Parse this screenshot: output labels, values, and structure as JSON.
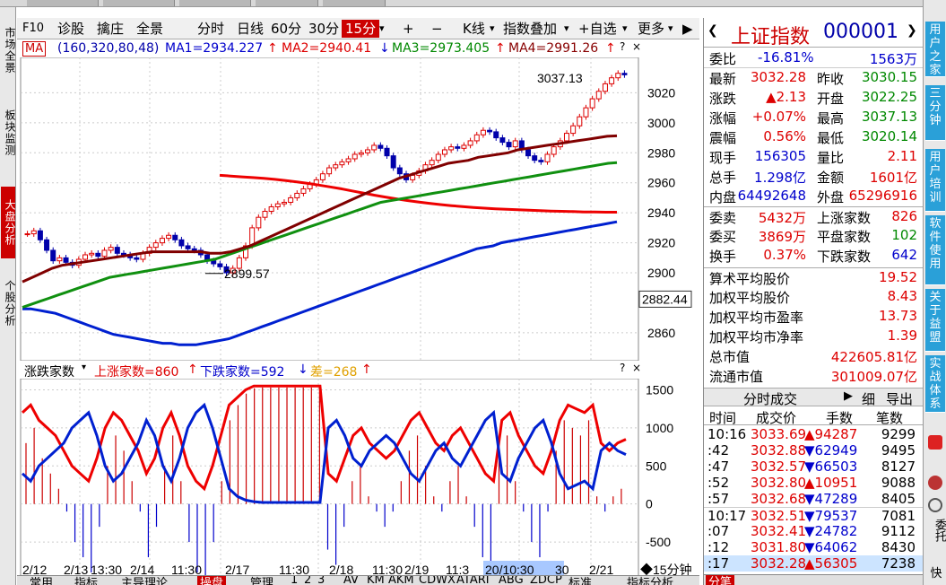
{
  "toolbar": {
    "items": [
      "F10",
      "诊股",
      "擒庄",
      "全景",
      "分时",
      "日线",
      "60分",
      "30分",
      "15分",
      "▾",
      "+",
      "−",
      "K线",
      "▾",
      "指数叠加",
      "▾",
      "+自选",
      "▾",
      "更多",
      "▾"
    ],
    "selected": "15分"
  },
  "left_tabs": [
    "市场全景",
    "板块监测",
    "大盘分析",
    "个股分析"
  ],
  "left_active": "大盘分析",
  "main_header": {
    "ma_label": "MA",
    "params": "(160,320,80,48)",
    "ma1": "MA1=2934.227",
    "ma2": "MA2=2940.41",
    "ma3": "MA3=2973.405",
    "ma4": "MA4=2991.26",
    "arrow_up": "↑",
    "arrow_down": "↓",
    "close_x": "×",
    "nav_right": "▶"
  },
  "sub_header": {
    "title": "涨跌家数",
    "up": "上涨家数=860",
    "down": "下跌家数=592",
    "diff": "差=268",
    "arrow_up": "↑",
    "arrow_down": "↓",
    "help": "?",
    "close_x": "×"
  },
  "price_tag": "2882.44",
  "max_annot": "3037.13",
  "min_annot": "2899.57",
  "x_ticks": [
    "2/12",
    "2/13",
    "13:30",
    "2/14",
    "11:30",
    "2/17",
    "11:30",
    "2/18",
    "11:30",
    "2/19",
    "11:3",
    "20/10:30",
    "30",
    "2/21"
  ],
  "x_period": "◆15分钟",
  "y_ticks_main": [
    "3020",
    "3000",
    "2980",
    "2960",
    "2940",
    "2920",
    "2900",
    "2860"
  ],
  "y_ticks_sub": [
    "1500",
    "1000",
    "500",
    "0",
    "-500"
  ],
  "chart_data": {
    "type": "line",
    "title": "",
    "xlabel": "",
    "ylabel": "",
    "ylim": [
      2845,
      3040
    ],
    "candles_close": [
      2926,
      2928,
      2922,
      2915,
      2908,
      2910,
      2907,
      2905,
      2909,
      2912,
      2913,
      2911,
      2915,
      2917,
      2913,
      2912,
      2910,
      2909,
      2913,
      2917,
      2920,
      2923,
      2925,
      2922,
      2918,
      2916,
      2915,
      2912,
      2908,
      2906,
      2904,
      2900,
      2903,
      2910,
      2918,
      2930,
      2937,
      2941,
      2944,
      2946,
      2947,
      2950,
      2953,
      2956,
      2959,
      2962,
      2966,
      2970,
      2972,
      2974,
      2976,
      2979,
      2980,
      2982,
      2985,
      2983,
      2978,
      2970,
      2966,
      2962,
      2965,
      2968,
      2972,
      2975,
      2979,
      2982,
      2984,
      2983,
      2985,
      2988,
      2992,
      2995,
      2994,
      2990,
      2987,
      2984,
      2988,
      2982,
      2978,
      2975,
      2974,
      2979,
      2984,
      2988,
      2993,
      2998,
      3004,
      3010,
      3016,
      3021,
      3026,
      3030,
      3033,
      3032
    ],
    "series": [
      {
        "name": "MA1",
        "values": [
          2876,
          2876,
          2875,
          2874,
          2873,
          2871,
          2869,
          2867,
          2865,
          2863,
          2861,
          2859,
          2858,
          2857,
          2856,
          2855,
          2854,
          2853,
          2853,
          2852,
          2852,
          2852,
          2853,
          2854,
          2855,
          2856,
          2858,
          2860,
          2862,
          2864,
          2866,
          2868,
          2870,
          2872,
          2874,
          2876,
          2878,
          2880,
          2882,
          2884,
          2886,
          2888,
          2890,
          2892,
          2894,
          2896,
          2898,
          2900,
          2902,
          2904,
          2906,
          2908,
          2910,
          2912,
          2914,
          2916,
          2917,
          2918,
          2920,
          2921,
          2922,
          2923,
          2924,
          2925,
          2926,
          2927,
          2928,
          2929,
          2930,
          2931,
          2932,
          2933,
          2934
        ]
      },
      {
        "name": "MA2",
        "values": [
          2965,
          2964.5,
          2964,
          2963.5,
          2963,
          2962.3,
          2961.5,
          2960.6,
          2959.6,
          2958.5,
          2957.3,
          2956,
          2954.6,
          2953.2,
          2951.8,
          2950.5,
          2949.3,
          2948.2,
          2947.2,
          2946.3,
          2945.5,
          2944.8,
          2944.2,
          2943.6,
          2943.1,
          2942.7,
          2942.3,
          2942,
          2941.7,
          2941.4,
          2941.2,
          2941,
          2940.8,
          2940.6,
          2940.5,
          2940.4,
          2940.4
        ]
      },
      {
        "name": "MA3",
        "values": [
          2877,
          2879,
          2881,
          2883,
          2885,
          2887,
          2889,
          2891,
          2893,
          2895,
          2897,
          2898,
          2899,
          2900,
          2901,
          2902,
          2903,
          2904,
          2905,
          2906,
          2907,
          2908,
          2909,
          2911,
          2913,
          2915,
          2917,
          2919,
          2921,
          2923,
          2925,
          2927,
          2929,
          2931,
          2933,
          2935,
          2937,
          2939,
          2941,
          2943,
          2945,
          2947,
          2948,
          2949,
          2950,
          2951,
          2952,
          2953,
          2954,
          2955,
          2956,
          2957,
          2958,
          2959,
          2960,
          2961,
          2962,
          2963,
          2964,
          2965,
          2966,
          2967,
          2968,
          2969,
          2970,
          2971,
          2972,
          2973,
          2973.4
        ]
      },
      {
        "name": "MA4",
        "values": [
          2894,
          2897,
          2900,
          2903,
          2905,
          2906,
          2907,
          2908,
          2909,
          2910,
          2911,
          2912,
          2913,
          2914,
          2914,
          2914,
          2914,
          2914,
          2914,
          2913,
          2913,
          2914,
          2916,
          2918,
          2921,
          2924,
          2927,
          2930,
          2933,
          2936,
          2939,
          2942,
          2945,
          2948,
          2951,
          2954,
          2957,
          2960,
          2963,
          2965,
          2967,
          2969,
          2971,
          2973,
          2974,
          2975,
          2977,
          2978,
          2979,
          2980,
          2982,
          2983,
          2984,
          2985,
          2986,
          2987,
          2988,
          2989,
          2990,
          2991,
          2991.3
        ]
      }
    ],
    "sub": {
      "type": "line",
      "ylim": [
        -900,
        1600
      ],
      "up": [
        1200,
        1300,
        1100,
        1000,
        900,
        700,
        500,
        400,
        300,
        600,
        1000,
        1200,
        1100,
        900,
        700,
        400,
        600,
        1000,
        1200,
        900,
        500,
        300,
        200,
        500,
        900,
        1300,
        1400,
        1500,
        1550,
        1550,
        1550,
        1550,
        1550,
        1550,
        1550,
        1550,
        1550,
        400,
        300,
        600,
        900,
        1000,
        800,
        700,
        600,
        700,
        900,
        1100,
        1200,
        1000,
        800,
        700,
        900,
        1000,
        800,
        600,
        400,
        300,
        1100,
        1200,
        900,
        700,
        500,
        400,
        700,
        1100,
        1300,
        1250,
        1200,
        1300,
        800,
        700,
        800,
        850
      ],
      "down": [
        400,
        300,
        500,
        600,
        700,
        800,
        1000,
        1100,
        1200,
        900,
        500,
        300,
        400,
        600,
        800,
        1100,
        900,
        500,
        300,
        600,
        1000,
        1200,
        1300,
        1000,
        600,
        200,
        100,
        50,
        30,
        20,
        20,
        20,
        20,
        20,
        20,
        20,
        20,
        1000,
        1100,
        900,
        600,
        500,
        700,
        800,
        900,
        800,
        600,
        400,
        300,
        500,
        700,
        800,
        600,
        500,
        700,
        900,
        1100,
        1200,
        400,
        300,
        600,
        800,
        1000,
        1100,
        800,
        400,
        200,
        250,
        300,
        200,
        700,
        800,
        700,
        650
      ],
      "diff": [
        800,
        1000,
        600,
        400,
        200,
        -100,
        -500,
        -700,
        -900,
        -300,
        500,
        900,
        700,
        300,
        -100,
        -700,
        -300,
        500,
        900,
        300,
        -500,
        -900,
        -1100,
        -500,
        300,
        1100,
        1300,
        1450,
        1520,
        1530,
        1530,
        1530,
        1530,
        1530,
        1530,
        1530,
        1530,
        -600,
        -800,
        -300,
        300,
        500,
        100,
        -100,
        -300,
        -100,
        300,
        700,
        900,
        500,
        100,
        -100,
        300,
        500,
        100,
        -300,
        -700,
        -900,
        700,
        900,
        300,
        -100,
        -500,
        -700,
        -100,
        700,
        1100,
        1000,
        900,
        1100,
        100,
        -100,
        100,
        200
      ]
    }
  },
  "quote": {
    "name": "上证指数",
    "code": "000001",
    "rows": [
      {
        "l1": "委比",
        "v1": "-16.81%",
        "l2": "",
        "v2": "1563万"
      },
      {
        "l1": "最新",
        "v1": "3032.28",
        "l2": "昨收",
        "v2": "3030.15"
      },
      {
        "l1": "涨跌",
        "v1": "▲2.13",
        "l2": "开盘",
        "v2": "3022.25"
      },
      {
        "l1": "涨幅",
        "v1": "+0.07%",
        "l2": "最高",
        "v2": "3037.13"
      },
      {
        "l1": "震幅",
        "v1": "0.56%",
        "l2": "最低",
        "v2": "3020.14"
      },
      {
        "l1": "现手",
        "v1": "156305",
        "l2": "量比",
        "v2": "2.11"
      },
      {
        "l1": "总手",
        "v1": "1.298亿",
        "l2": "金额",
        "v2": "1601亿"
      },
      {
        "l1": "内盘",
        "v1": "64492648",
        "l2": "外盘",
        "v2": "65296916"
      }
    ],
    "rows2": [
      {
        "l1": "委卖",
        "v1": "5432万",
        "l2": "上涨家数",
        "v2": "826"
      },
      {
        "l1": "委买",
        "v1": "3869万",
        "l2": "平盘家数",
        "v2": "102"
      },
      {
        "l1": "换手",
        "v1": "0.37%",
        "l2": "下跌家数",
        "v2": "642"
      }
    ],
    "rows3": [
      {
        "l": "算术平均股价",
        "v": "19.52"
      },
      {
        "l": "加权平均股价",
        "v": "8.43"
      },
      {
        "l": "加权平均市盈率",
        "v": "13.73"
      },
      {
        "l": "加权平均市净率",
        "v": "1.39"
      },
      {
        "l": "总市值",
        "v": "422605.81亿"
      },
      {
        "l": "流通市值",
        "v": "301009.07亿"
      }
    ]
  },
  "tick_table": {
    "tab_label": "分时成交",
    "tab2": "细",
    "tab3": "导出",
    "headers": [
      "时间",
      "成交价",
      "手数",
      "笔数"
    ],
    "rows": [
      {
        "t": "10:16",
        "p": "3033.69",
        "h": "▲94287",
        "n": "9299"
      },
      {
        "t": ":42",
        "p": "3032.88",
        "h": "▼62949",
        "n": "9495"
      },
      {
        "t": ":47",
        "p": "3032.57",
        "h": "▼66503",
        "n": "8127"
      },
      {
        "t": ":52",
        "p": "3032.80",
        "h": "▲10951",
        "n": "9088"
      },
      {
        "t": ":57",
        "p": "3032.68",
        "h": "▼47289",
        "n": "8405"
      },
      {
        "t": "10:17",
        "p": "3032.51",
        "h": "▼79537",
        "n": "7081"
      },
      {
        "t": ":07",
        "p": "3032.41",
        "h": "▼24782",
        "n": "9112"
      },
      {
        "t": ":12",
        "p": "3031.80",
        "h": "▼64062",
        "n": "8430"
      },
      {
        "t": ":17",
        "p": "3032.28",
        "h": "▲56305",
        "n": "7238"
      }
    ]
  },
  "far_right_tabs": [
    "用户之家",
    "三分钟",
    "用户培训",
    "软件使用",
    "关于益盟",
    "实战体系"
  ],
  "far_right_icons": [
    "委托",
    "快"
  ],
  "bottom_tabs": [
    "常用",
    "指标",
    "主导理论",
    "操盘",
    "管理",
    "1",
    "2",
    "3",
    "AV",
    "KM",
    "AKM",
    "CDWX",
    "ATARI",
    "ABG",
    "ZDCP",
    "标准",
    "指标分析"
  ],
  "bottom_active": "操盘"
}
